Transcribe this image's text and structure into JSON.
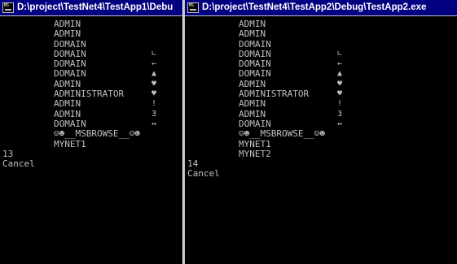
{
  "window1": {
    "title": "D:\\project\\TestNet4\\TestApp1\\Debu",
    "icon": "msdos-console-icon",
    "names": [
      {
        "name": "ADMIN",
        "sym": ""
      },
      {
        "name": "ADMIN",
        "sym": ""
      },
      {
        "name": "DOMAIN",
        "sym": ""
      },
      {
        "name": "DOMAIN",
        "sym": "∟"
      },
      {
        "name": "DOMAIN",
        "sym": "←"
      },
      {
        "name": "DOMAIN",
        "sym": "▲"
      },
      {
        "name": "ADMIN",
        "sym": "♥"
      },
      {
        "name": "ADMINISTRATOR",
        "sym": "♥"
      },
      {
        "name": "ADMIN",
        "sym": "!"
      },
      {
        "name": "ADMIN",
        "sym": "3"
      },
      {
        "name": "DOMAIN",
        "sym": "↔"
      },
      {
        "name": "☺☻__MSBROWSE__☺☻",
        "sym": ""
      },
      {
        "name": "MYNET1",
        "sym": ""
      }
    ],
    "count": "13",
    "status": "Cancel"
  },
  "window2": {
    "title": "D:\\project\\TestNet4\\TestApp2\\Debug\\TestApp2.exe",
    "icon": "msdos-console-icon",
    "names": [
      {
        "name": "ADMIN",
        "sym": ""
      },
      {
        "name": "ADMIN",
        "sym": ""
      },
      {
        "name": "DOMAIN",
        "sym": ""
      },
      {
        "name": "DOMAIN",
        "sym": "∟"
      },
      {
        "name": "DOMAIN",
        "sym": "←"
      },
      {
        "name": "DOMAIN",
        "sym": "▲"
      },
      {
        "name": "ADMIN",
        "sym": "♥"
      },
      {
        "name": "ADMINISTRATOR",
        "sym": "♥"
      },
      {
        "name": "ADMIN",
        "sym": "!"
      },
      {
        "name": "ADMIN",
        "sym": "3"
      },
      {
        "name": "DOMAIN",
        "sym": "↔"
      },
      {
        "name": "☺☻__MSBROWSE__☺☻",
        "sym": ""
      },
      {
        "name": "MYNET1",
        "sym": ""
      },
      {
        "name": "MYNET2",
        "sym": ""
      }
    ],
    "count": "14",
    "status": "Cancel"
  },
  "colors": {
    "titlebar": "#000080",
    "console_bg": "#000000",
    "console_text": "#c0c0c0"
  }
}
